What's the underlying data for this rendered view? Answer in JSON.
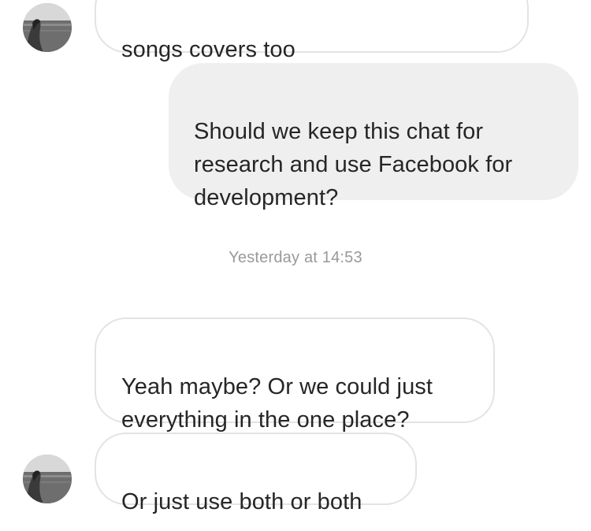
{
  "chat": {
    "messages": [
      {
        "id": "m1",
        "direction": "incoming",
        "text": "songs covers too",
        "has_avatar": true
      },
      {
        "id": "m2",
        "direction": "outgoing",
        "text": "Should we keep this chat for\nresearch and use Facebook for\ndevelopment?"
      },
      {
        "id": "m3",
        "direction": "incoming",
        "text": "Yeah maybe? Or we could just\neverything in the one place?",
        "has_avatar": false
      },
      {
        "id": "m4",
        "direction": "incoming",
        "text": "Or just use both or both",
        "has_avatar": true
      }
    ],
    "timestamp": "Yesterday at 14:53"
  },
  "colors": {
    "incoming_bubble_border": "#e3e3e3",
    "outgoing_bubble_bg": "#efefef",
    "timestamp_text": "#999999",
    "message_text": "#262626"
  },
  "icons": {
    "avatar": "contact-avatar-photo"
  }
}
